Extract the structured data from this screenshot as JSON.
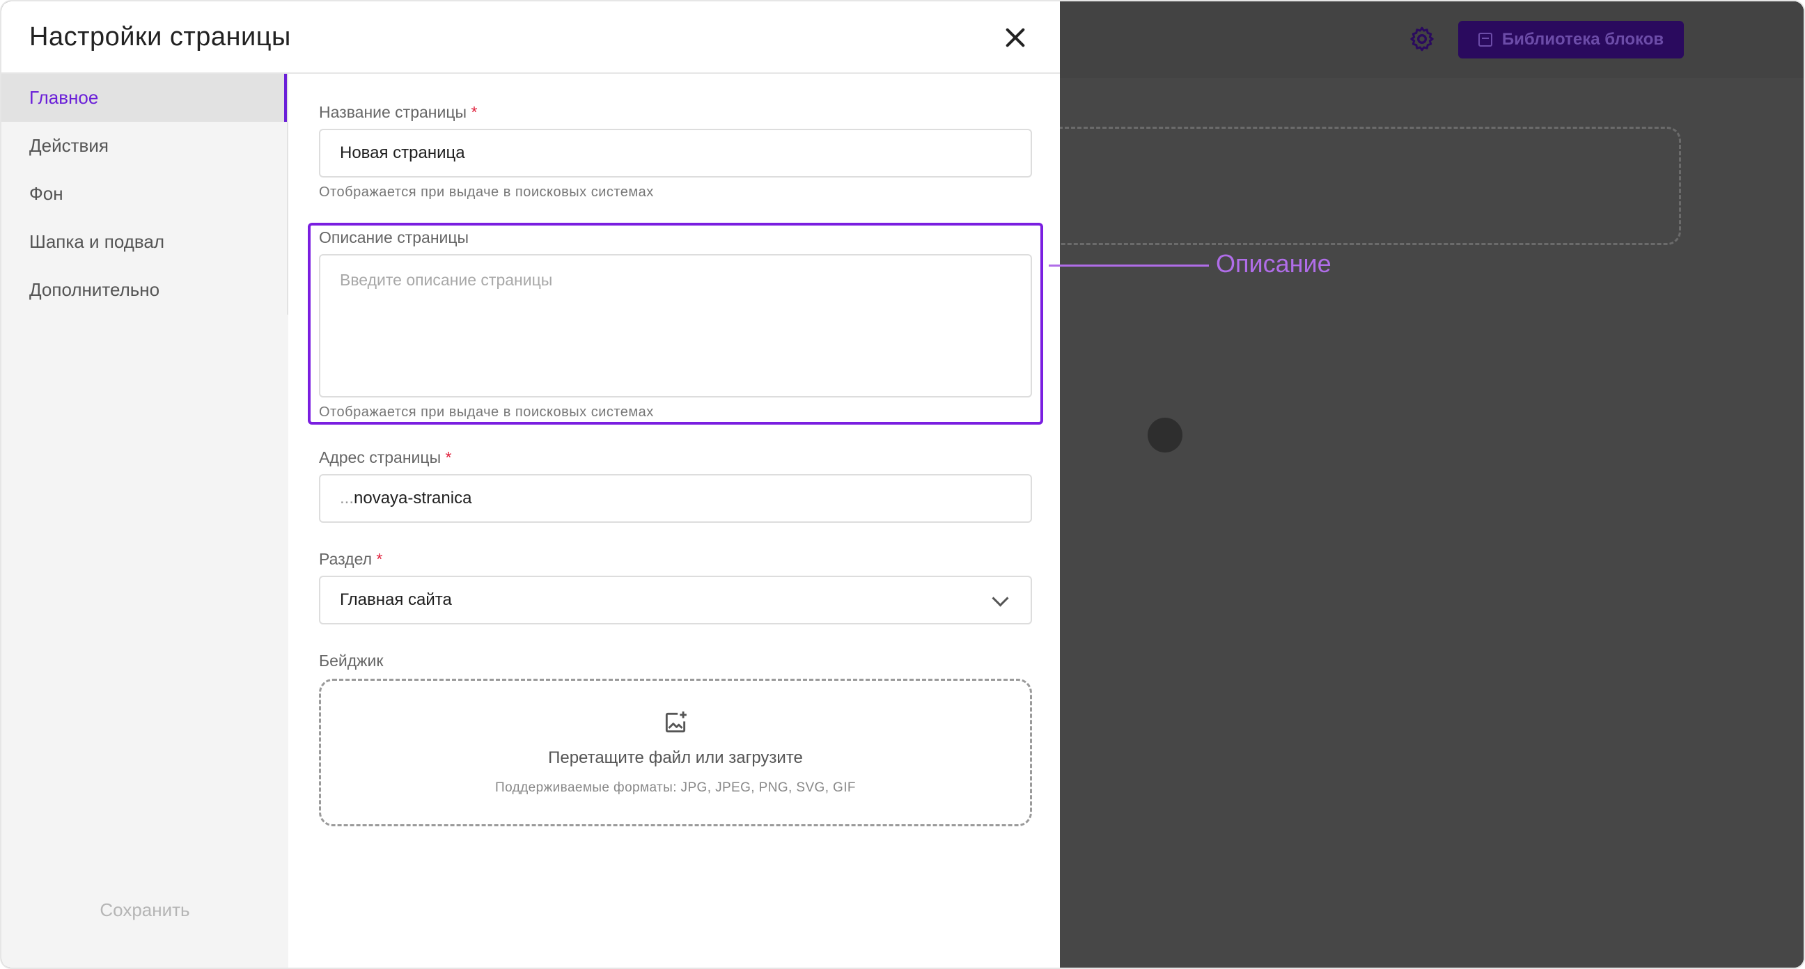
{
  "modal": {
    "title": "Настройки страницы"
  },
  "sidebar": {
    "items": [
      {
        "label": "Главное",
        "active": true
      },
      {
        "label": "Действия"
      },
      {
        "label": "Фон"
      },
      {
        "label": "Шапка и подвал"
      },
      {
        "label": "Дополнительно"
      }
    ],
    "save_label": "Сохранить"
  },
  "form": {
    "page_name": {
      "label": "Название страницы",
      "required_mark": "*",
      "value": "Новая страница",
      "hint": "Отображается при выдаче в поисковых системах"
    },
    "description": {
      "label": "Описание страницы",
      "placeholder": "Введите описание страницы",
      "hint": "Отображается при выдаче в поисковых системах"
    },
    "address": {
      "label": "Адрес страницы",
      "required_mark": "*",
      "prefix": "...",
      "value": "novaya-stranica"
    },
    "section": {
      "label": "Раздел",
      "required_mark": "*",
      "value": "Главная сайта"
    },
    "badge": {
      "label": "Бейджик",
      "drop_title": "Перетащите файл или загрузите",
      "drop_formats": "Поддерживаемые форматы: JPG, JPEG, PNG, SVG, GIF"
    }
  },
  "background": {
    "library_button": "Библиотека блоков"
  },
  "annotation": {
    "label": "Описание"
  },
  "colors": {
    "accent": "#6a1fd8",
    "highlight": "#7a1ee0",
    "callout": "#b06de8",
    "overlay": "#474747",
    "required": "#e0203c"
  },
  "icons": [
    "close-icon",
    "gear-icon",
    "library-icon",
    "chevron-down-icon",
    "image-upload-icon"
  ]
}
